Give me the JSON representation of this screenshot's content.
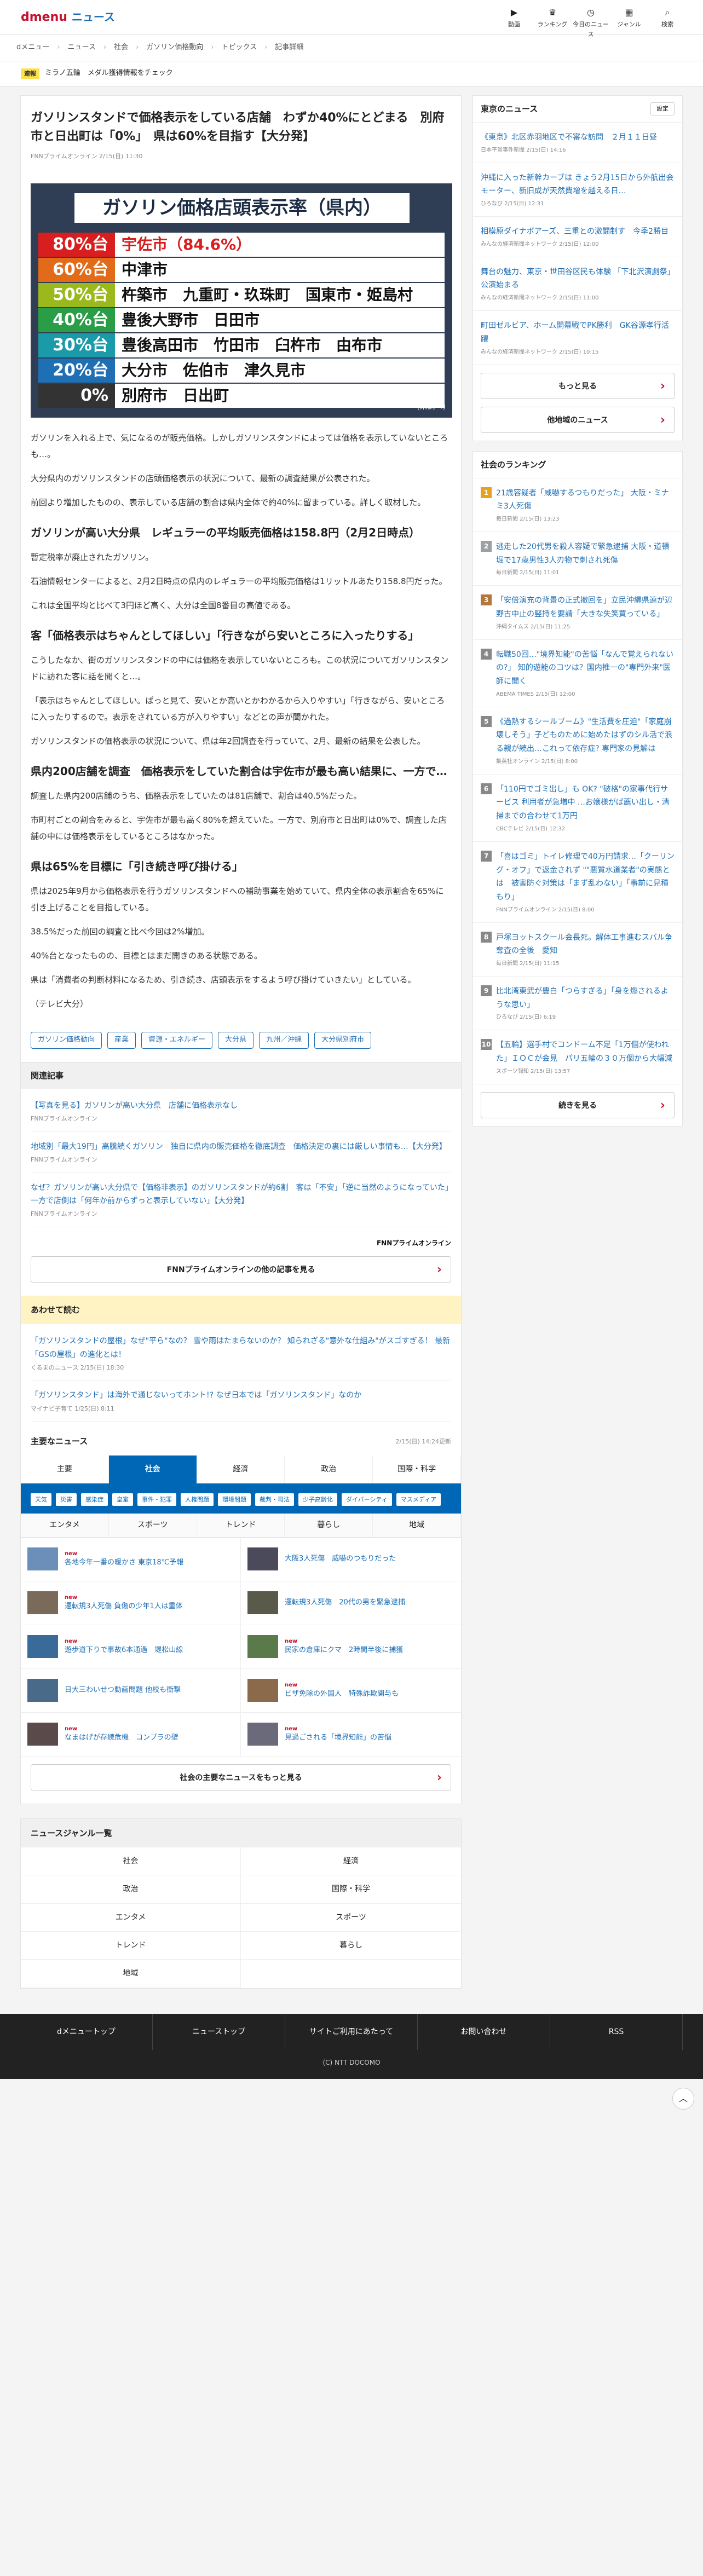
{
  "header": {
    "logo": "dmenu",
    "section": "ニュース",
    "nav": [
      {
        "label": "動画",
        "icon": "video-icon"
      },
      {
        "label": "ランキング",
        "icon": "crown-icon"
      },
      {
        "label": "今日のニュース",
        "icon": "clock-icon"
      },
      {
        "label": "ジャンル",
        "icon": "grid-icon"
      },
      {
        "label": "検索",
        "icon": "search-icon"
      }
    ]
  },
  "breadcrumb": [
    "dメニュー",
    "ニュース",
    "社会",
    "ガソリン価格動向",
    "トピックス",
    "記事詳細"
  ],
  "ticker": {
    "badge": "速報",
    "text": "ミラノ五輪　メダル獲得情報をチェック"
  },
  "article": {
    "title": "ガソリンスタンドで価格表示をしている店舗　わずか40%にとどまる　別府市と日出町は「0%」　県は60%を目指す【大分発】",
    "meta": "FNNプライムオンライン 2/15(日) 11:30",
    "hero": {
      "title": "ガソリン価格店頭表示率（県内）",
      "rows": [
        {
          "pct": "80%台",
          "color": "#d81e1e",
          "cities": "宇佐市（84.6%）",
          "accent": true
        },
        {
          "pct": "60%台",
          "color": "#e26b1a",
          "cities": "中津市"
        },
        {
          "pct": "50%台",
          "color": "#9bb81c",
          "cities": "杵築市　九重町・玖珠町　国東市・姫島村"
        },
        {
          "pct": "40%台",
          "color": "#2a9d47",
          "cities": "豊後大野市　日田市"
        },
        {
          "pct": "30%台",
          "color": "#1b9aaa",
          "cities": "豊後高田市　竹田市　臼杵市　由布市"
        },
        {
          "pct": "20%台",
          "color": "#1f6fb5",
          "cities": "大分市　佐伯市　津久見市"
        },
        {
          "pct": "0%",
          "color": "#333333",
          "cities": "別府市　日出町"
        }
      ],
      "credit": "(県調べ)"
    },
    "p1": "ガソリンを入れる上で、気になるのが販売価格。しかしガソリンスタンドによっては価格を表示していないところも…。",
    "p2": "大分県内のガソリンスタンドの店頭価格表示の状況について、最新の調査結果が公表された。",
    "p3": "前回より増加したものの、表示している店舗の割合は県内全体で約40%に留まっている。詳しく取材した。",
    "h2a": "ガソリンが高い大分県　レギュラーの平均販売価格は158.8円（2月2日時点）",
    "p4": "暫定税率が廃止されたガソリン。",
    "p5": "石油情報センターによると、2月2日時点の県内のレギュラーの平均販売価格は1リットルあたり158.8円だった。",
    "p6": "これは全国平均と比べて3円ほど高く、大分は全国8番目の高値である。",
    "h2b": "客「価格表示はちゃんとしてほしい」「行きながら安いところに入ったりする」",
    "p7": "こうしたなか、街のガソリンスタンドの中には価格を表示していないところも。この状況についてガソリンスタンドに訪れた客に話を聞くと…。",
    "p8": "「表示はちゃんとしてほしい。ぱっと見て、安いとか高いとかわかるから入りやすい」「行きながら、安いところに入ったりするので。表示をされている方が入りやすい」などとの声が聞かれた。",
    "p9": "ガソリンスタンドの価格表示の状況について、県は年2回調査を行っていて、2月、最新の結果を公表した。",
    "h2c": "県内200店舗を調査　価格表示をしていた割合は宇佐市が最も高い結果に、一方で…",
    "p10": "調査した県内200店舗のうち、価格表示をしていたのは81店舗で、割合は40.5%だった。",
    "p11": "市町村ごとの割合をみると、宇佐市が最も高く80%を超えていた。一方で、別府市と日出町は0%で、調査した店舗の中には価格表示をしているところはなかった。",
    "h2d": "県は65%を目標に「引き続き呼び掛ける」",
    "p12": "県は2025年9月から価格表示を行うガソリンスタンドへの補助事業を始めていて、県内全体の表示割合を65%に引き上げることを目指している。",
    "p13": "38.5%だった前回の調査と比べ今回は2%増加。",
    "p14": "40%台となったものの、目標とはまだ開きのある状態である。",
    "p15": "県は「消費者の判断材料になるため、引き続き、店頭表示をするよう呼び掛けていきたい」としている。",
    "p16": "（テレビ大分）",
    "tags": [
      "ガソリン価格動向",
      "産業",
      "資源・エネルギー",
      "大分県",
      "九州／沖縄",
      "大分県別府市"
    ]
  },
  "related": {
    "heading": "関連記事",
    "items": [
      {
        "title": "【写真を見る】ガソリンが高い大分県　店舗に価格表示なし",
        "src": "FNNプライムオンライン"
      },
      {
        "title": "地域別「最大19円」高騰続くガソリン　独自に県内の販売価格を徹底調査　価格決定の裏には厳しい事情も…【大分発】",
        "src": "FNNプライムオンライン"
      },
      {
        "title": "なぜ？ガソリンが高い大分県で【価格非表示】のガソリンスタンドが約6割　客は「不安」「逆に当然のようになっていた」一方で店側は「何年か前からずっと表示していない」【大分発】",
        "src": "FNNプライムオンライン"
      }
    ],
    "provider": "FNNプライムオンライン",
    "more": "FNNプライムオンラインの他の記事を見る"
  },
  "also": {
    "heading": "あわせて読む",
    "items": [
      {
        "title": "「ガソリンスタンドの屋根」なぜ\"平ら\"なの？ 雪や雨はたまらないのか？ 知られざる\"意外な仕組み\"がスゴすぎる！ 最新「GSの屋根」の進化とは！",
        "src": "くるまのニュース 2/15(日) 18:30"
      },
      {
        "title": "「ガソリンスタンド」は海外で通じないってホント!? なぜ日本では「ガソリンスタンド」なのか",
        "src": "マイナビ子育て 1/25(日) 8:11"
      }
    ]
  },
  "mainnews": {
    "heading": "主要なニュース",
    "date": "2/15(日) 14:24更新",
    "tabs": [
      "主要",
      "社会",
      "経済",
      "政治",
      "国際・科学"
    ],
    "chips": [
      "天気",
      "災害",
      "感染症",
      "皇室",
      "事件・犯罪",
      "人権問題",
      "環境問題",
      "裁判・司法",
      "少子高齢化",
      "ダイバーシティ",
      "マスメディア"
    ],
    "subtabs": [
      "エンタメ",
      "スポーツ",
      "トレンド",
      "暮らし",
      "地域"
    ],
    "items": [
      {
        "title": "各地今年一番の暖かさ 東京18℃予報",
        "new": true,
        "color": "#6b8fb8"
      },
      {
        "title": "大阪3人死傷　威嚇のつもりだった",
        "new": false,
        "color": "#4a4a5a"
      },
      {
        "title": "運転規3人死傷 負傷の少年1人は重体",
        "new": true,
        "color": "#7a6a5a"
      },
      {
        "title": "運転規3人死傷　20代の男を緊急逮捕",
        "new": false,
        "color": "#5a5a4a"
      },
      {
        "title": "遊歩道下りで事故6本通過　堤松山線",
        "new": true,
        "color": "#3a6a9a"
      },
      {
        "title": "民家の倉庫にクマ　2時間半後に捕獲",
        "new": true,
        "color": "#5a7a4a"
      },
      {
        "title": "日大三わいせつ動画問題 他校も衝撃",
        "new": false,
        "color": "#4a6a8a"
      },
      {
        "title": "ビザ免除の外国人　特殊詐欺関与も",
        "new": true,
        "color": "#8a6a4a"
      },
      {
        "title": "なまはげが存続危機　コンプラの壁",
        "new": true,
        "color": "#5a4a4a"
      },
      {
        "title": "見過ごされる「境界知能」の苦悩",
        "new": true,
        "color": "#6a6a7a"
      }
    ],
    "more": "社会の主要なニュースをもっと見る"
  },
  "local": {
    "heading": "東京のニュース",
    "settings": "設定",
    "items": [
      {
        "title": "《東京》北区赤羽地区で不審な訪問　２月１１日昼",
        "src": "日本平常事件新聞 2/15(日) 14:16"
      },
      {
        "title": "沖縄に入った新幹カーブは きょう2月15日から外航出会モーター、新旧成が天然費増を越える日…",
        "src": "ひろなび 2/15(日) 12:31"
      },
      {
        "title": "相模原ダイナボアーズ、三重との激闘制す　今季2勝目",
        "src": "みんなの経済新聞ネットワーク 2/15(日) 12:00"
      },
      {
        "title": "舞台の魅力、東京・世田谷区民も体験 「下北沢演劇祭」公演始まる",
        "src": "みんなの経済新聞ネットワーク 2/15(日) 11:00"
      },
      {
        "title": "町田ゼルビア、ホーム開幕戦でPK勝利　GK谷源孝行活躍",
        "src": "みんなの経済新聞ネットワーク 2/15(日) 10:15"
      }
    ],
    "more": "もっと見る",
    "other": "他地域のニュース"
  },
  "ranking": {
    "heading": "社会のランキング",
    "items": [
      {
        "n": "1",
        "title": "21歳容疑者「威嚇するつもりだった」 大阪・ミナミ3人死傷",
        "src": "毎日新聞 2/15(日) 13:23",
        "color": "#e7a11f"
      },
      {
        "n": "2",
        "title": "逃走した20代男を殺人容疑で緊急逮捕 大阪・道頓堀で17歳男性3人刃物で刺され死傷",
        "src": "毎日新聞 2/15(日) 11:01",
        "color": "#9aa0a6"
      },
      {
        "n": "3",
        "title": "「安倍演充の背景の正式撤回を」立民沖縄県連が辺野古中止の竪持を要請「大きな失笑買っている」",
        "src": "沖縄タイムス 2/15(日) 11:25",
        "color": "#b2773d"
      },
      {
        "n": "4",
        "title": "転職50回…\"境界知能\"の苦悩「なんで覚えられないの?」 知的遊能のコツは？国内推一の\"専門外来\"医師に聞く",
        "src": "ABEMA TIMES 2/15(日) 12:00",
        "color": "#888"
      },
      {
        "n": "5",
        "title": "《過熱するシールブーム》\"生活費を圧迫\"「家庭崩壊しそう」子どものために始めたはずのシル活で浪る親が続出…これって依存症? 専門家の見解は",
        "src": "集英社オンライン 2/15(日) 8:00",
        "color": "#888"
      },
      {
        "n": "6",
        "title": "「110円でゴミ出し」も OK? \"破格\"の家事代行サービス 利用者が急増中 …お嬢様がば薦い出し・清掃までの合わせて1万円",
        "src": "CBCテレビ 2/15(日) 12:32",
        "color": "#888"
      },
      {
        "n": "7",
        "title": "「喜はゴミ」トイレ修理で40万円請求…「クーリング・オフ」で返金されず \"\"悪質水道業者\"の実態とは　被害防ぐ対策は「まず乱わない」「事前に見積もり」",
        "src": "FNNプライムオンライン 2/15(日) 8:00",
        "color": "#888"
      },
      {
        "n": "8",
        "title": "戸塚ヨットスクール会長死。解体工事進むスバル争奪査の全後　愛知",
        "src": "毎日新聞 2/15(日) 11:15",
        "color": "#888"
      },
      {
        "n": "9",
        "title": "比北湾東武が豊白「つらすぎる」「身を燃されるような思い」",
        "src": "ひろなび 2/15(日) 6:19",
        "color": "#888"
      },
      {
        "n": "10",
        "title": "【五輪】選手村でコンドーム不足「1万個が使われた」ＩＯＣが会見　パリ五輪の３０万個から大幅減",
        "src": "スポーツ報知 2/15(日) 13:57",
        "color": "#888"
      }
    ],
    "more": "続きを見る"
  },
  "genre": {
    "heading": "ニュースジャンル一覧",
    "items": [
      "社会",
      "経済",
      "政治",
      "国際・科学",
      "エンタメ",
      "スポーツ",
      "トレンド",
      "暮らし",
      "地域"
    ]
  },
  "footer": {
    "nav": [
      "dメニュートップ",
      "ニューストップ",
      "サイトご利用にあたって",
      "お問い合わせ",
      "RSS"
    ],
    "copy": "(C) NTT DOCOMO"
  }
}
